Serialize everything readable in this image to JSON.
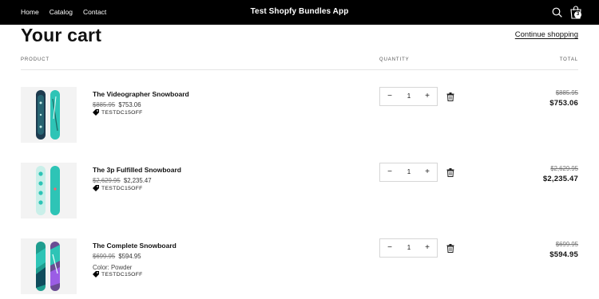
{
  "header": {
    "nav": [
      "Home",
      "Catalog",
      "Contact"
    ],
    "brand": "Test Shopfy Bundles App",
    "cart_count": "3"
  },
  "page": {
    "title": "Your cart",
    "continue_link": "Continue shopping",
    "columns": {
      "product": "PRODUCT",
      "quantity": "QUANTITY",
      "total": "TOTAL"
    }
  },
  "items": [
    {
      "name": "The Videographer Snowboard",
      "compare_price": "$885.95",
      "price": "$753.06",
      "variant": "",
      "discount": "TESTDC15OFF",
      "quantity": "1",
      "total_original": "$885.95",
      "total_final": "$753.06",
      "image": "snowboard-videographer"
    },
    {
      "name": "The 3p Fulfilled Snowboard",
      "compare_price": "$2,629.95",
      "price": "$2,235.47",
      "variant": "",
      "discount": "TESTDC15OFF",
      "quantity": "1",
      "total_original": "$2,629.95",
      "total_final": "$2,235.47",
      "image": "snowboard-3p-fulfilled"
    },
    {
      "name": "The Complete Snowboard",
      "compare_price": "$699.95",
      "price": "$594.95",
      "variant": "Color: Powder",
      "discount": "TESTDC15OFF",
      "quantity": "1",
      "total_original": "$699.95",
      "total_final": "$594.95",
      "image": "snowboard-complete"
    }
  ],
  "icons": {
    "search": "search-icon",
    "bag": "shopping-bag-icon",
    "minus": "minus-icon",
    "plus": "plus-icon",
    "trash": "trash-icon",
    "tag": "discount-tag-icon"
  },
  "colors": {
    "topbar": "#000000",
    "text": "#121212",
    "board_teal": "#2ec4b6",
    "board_dark": "#1d3b4f"
  }
}
